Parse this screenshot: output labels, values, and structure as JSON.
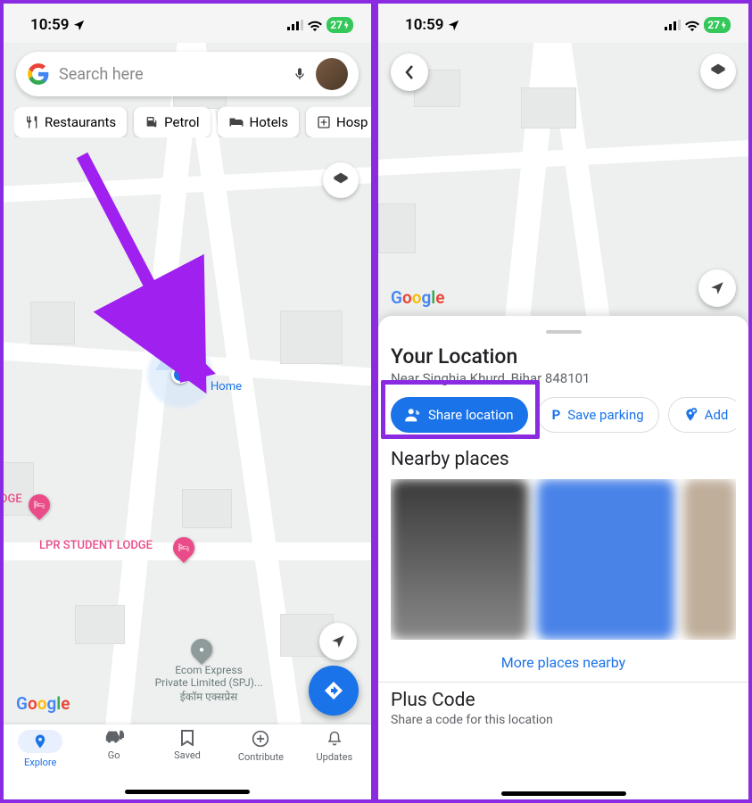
{
  "status": {
    "time": "10:59",
    "battery": "27"
  },
  "left": {
    "search_placeholder": "Search here",
    "chips": [
      "Restaurants",
      "Petrol",
      "Hotels",
      "Hosp"
    ],
    "home_label": "Home",
    "map_labels": {
      "lodge_trunc": "DGE",
      "lodge_full": "LPR STUDENT LODGE",
      "ecom1": "Ecom Express",
      "ecom2": "Private Limited (SPJ)...",
      "ecom3": "ईकॉम एक्सप्रेस"
    },
    "nav": {
      "explore": "Explore",
      "go": "Go",
      "saved": "Saved",
      "contribute": "Contribute",
      "updates": "Updates"
    }
  },
  "right": {
    "sheet_title": "Your Location",
    "sheet_sub": "Near Singhia Khurd, Bihar 848101",
    "actions": {
      "share": "Share location",
      "parking": "Save parking",
      "add": "Add"
    },
    "nearby_title": "Nearby places",
    "more_link": "More places nearby",
    "plus_title": "Plus Code",
    "plus_sub": "Share a code for this location"
  }
}
